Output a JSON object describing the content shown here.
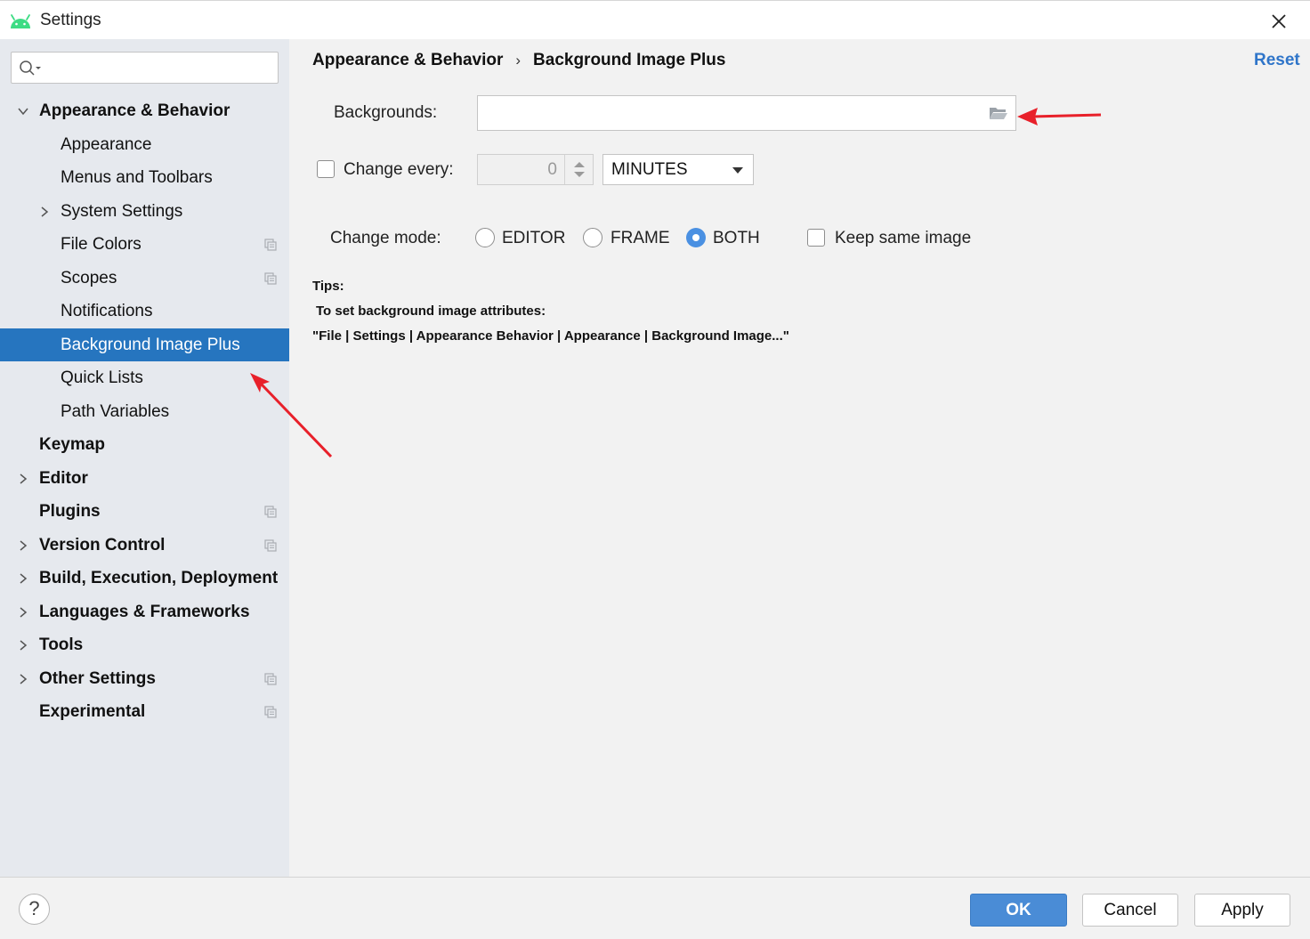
{
  "window": {
    "title": "Settings",
    "app_icon": "android-icon",
    "close_icon": "close-icon"
  },
  "sidebar": {
    "search": {
      "placeholder": "",
      "icon": "search-icon"
    },
    "items": [
      {
        "label": "Appearance & Behavior",
        "level": 0,
        "expandable": true,
        "expanded": true
      },
      {
        "label": "Appearance",
        "level": 1
      },
      {
        "label": "Menus and Toolbars",
        "level": 1
      },
      {
        "label": "System Settings",
        "level": 1,
        "expandable": true,
        "expanded": false
      },
      {
        "label": "File Colors",
        "level": 1,
        "project_icon": true
      },
      {
        "label": "Scopes",
        "level": 1,
        "project_icon": true
      },
      {
        "label": "Notifications",
        "level": 1
      },
      {
        "label": "Background Image Plus",
        "level": 1,
        "selected": true
      },
      {
        "label": "Quick Lists",
        "level": 1
      },
      {
        "label": "Path Variables",
        "level": 1
      },
      {
        "label": "Keymap",
        "level": 0
      },
      {
        "label": "Editor",
        "level": 0,
        "expandable": true,
        "expanded": false
      },
      {
        "label": "Plugins",
        "level": 0,
        "project_icon": true
      },
      {
        "label": "Version Control",
        "level": 0,
        "expandable": true,
        "expanded": false,
        "project_icon": true
      },
      {
        "label": "Build, Execution, Deployment",
        "level": 0,
        "expandable": true,
        "expanded": false
      },
      {
        "label": "Languages & Frameworks",
        "level": 0,
        "expandable": true,
        "expanded": false
      },
      {
        "label": "Tools",
        "level": 0,
        "expandable": true,
        "expanded": false
      },
      {
        "label": "Other Settings",
        "level": 0,
        "expandable": true,
        "expanded": false,
        "project_icon": true
      },
      {
        "label": "Experimental",
        "level": 0,
        "project_icon": true
      }
    ]
  },
  "header": {
    "breadcrumb_parent": "Appearance & Behavior",
    "breadcrumb_separator": "›",
    "breadcrumb_current": "Background Image Plus",
    "reset_label": "Reset"
  },
  "form": {
    "backgrounds_label": "Backgrounds:",
    "backgrounds_value": "",
    "change_every_label": "Change every:",
    "change_every_checked": false,
    "interval_value": "0",
    "interval_unit": "MINUTES",
    "change_mode_label": "Change mode:",
    "modes": [
      {
        "label": "EDITOR",
        "selected": false
      },
      {
        "label": "FRAME",
        "selected": false
      },
      {
        "label": "BOTH",
        "selected": true
      }
    ],
    "keep_same_image_label": "Keep same image",
    "keep_same_image_checked": false
  },
  "tips": {
    "title": "Tips:",
    "line1": "To set background image attributes:",
    "line2": "\"File | Settings | Appearance  Behavior | Appearance | Background Image...\""
  },
  "footer": {
    "help_label": "?",
    "ok_label": "OK",
    "cancel_label": "Cancel",
    "apply_label": "Apply"
  },
  "colors": {
    "accent": "#2675bf",
    "link": "#2f75c9",
    "ok_button": "#4a8cd6",
    "annotation_arrow": "#e8202a",
    "sidebar_bg": "#e6e9ee"
  }
}
